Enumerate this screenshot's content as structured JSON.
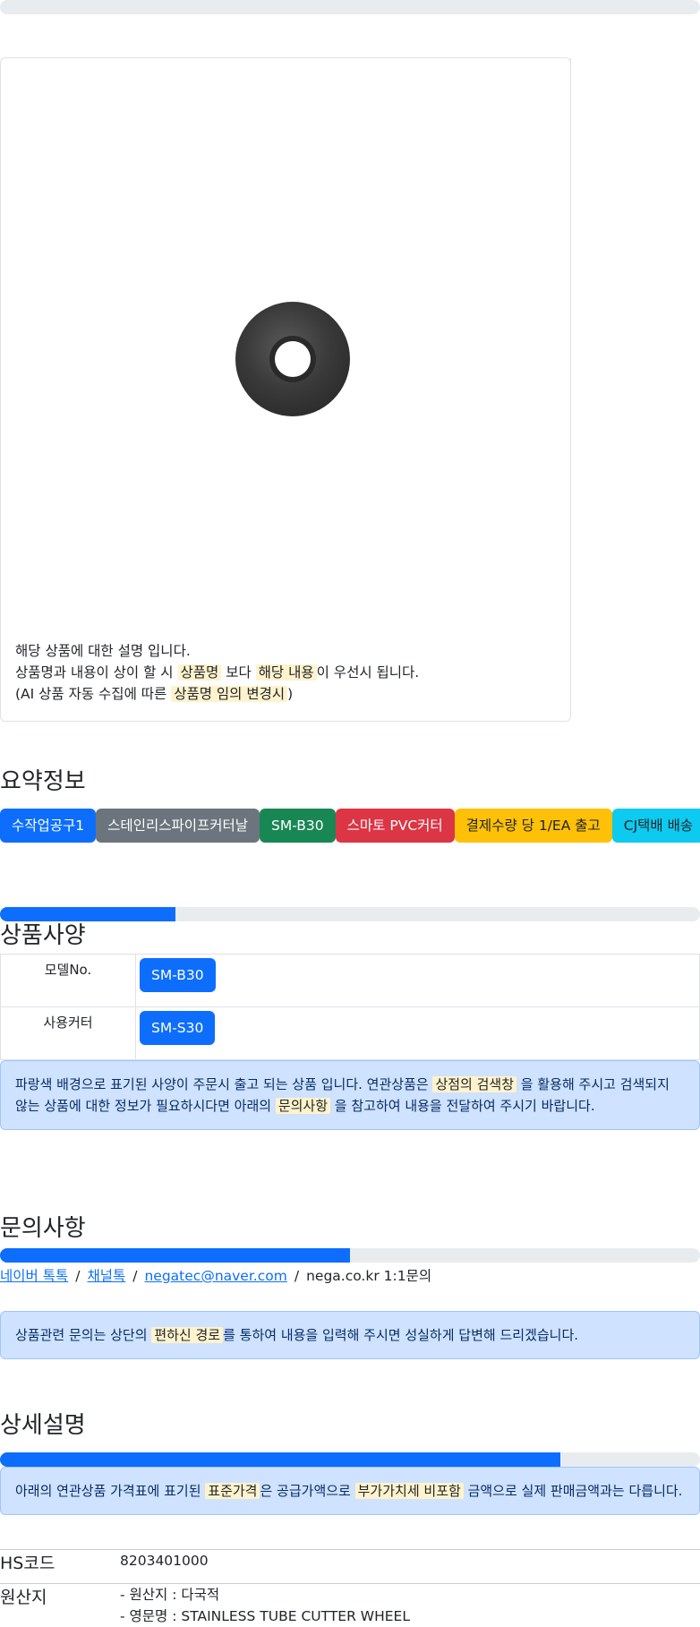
{
  "top_progress": 0,
  "card": {
    "image_alt": "stainless tube cutter wheel",
    "line1": "해당 상품에 대한 설명 입니다.",
    "line2_pre": "상품명과 내용이 상이 할 시 ",
    "line2_mark1": "상품명",
    "line2_mid": " 보다 ",
    "line2_mark2": "해당 내용",
    "line2_post": "이 우선시 됩니다.",
    "line3_pre": "(AI 상품 자동 수집에 따른 ",
    "line3_mark": "상품명 임의 변경시",
    "line3_post": ")"
  },
  "summary": {
    "title": "요약정보",
    "badges": [
      "수작업공구1",
      "스테인리스파이프커터날",
      "SM-B30",
      "스마토 PVC커터",
      "결제수량 당 1/EA 출고",
      "CJ택배 배송"
    ]
  },
  "spec": {
    "progress": 0.25,
    "title": "상품사양",
    "rows": [
      {
        "label": "모델No.",
        "value": "SM-B30"
      },
      {
        "label": "사용커터",
        "value": "SM-S30"
      }
    ],
    "notice_pre": "파랑색 배경으로 표기된 사양이 주문시 출고 되는 상품 입니다. 연관상품은 ",
    "notice_mark1": "상점의 검색창",
    "notice_mid": " 을 활용해 주시고 검색되지 않는 상품에 대한 정보가 필요하시다면 아래의 ",
    "notice_mark2": "문의사항",
    "notice_post": " 을 참고하여 내용을 전달하여 주시기 바랍니다."
  },
  "inquiry": {
    "title": "문의사항",
    "progress": 0.5,
    "links": [
      "네이버 톡톡",
      "채널톡",
      "negatec@naver.com"
    ],
    "plain": "nega.co.kr 1:1문의",
    "separator": "/",
    "notice_pre": "상품관련 문의는 상단의 ",
    "notice_mark": "편하신 경로",
    "notice_post": "를 통하여 내용을 입력해 주시면 성실하게 답변해 드리겠습니다."
  },
  "detail": {
    "title": "상세설명",
    "progress": 0.8,
    "notice_pre": "아래의 연관상품 가격표에 표기된 ",
    "notice_mark1": "표준가격",
    "notice_mid": "은 공급가액으로 ",
    "notice_mark2": "부가가치세 비포함",
    "notice_post": " 금액으로 실제 판매금액과는 다릅니다.",
    "hs_label": "HS코드",
    "hs_value": "8203401000",
    "origin_label": "원산지",
    "origin_line1": "- 원산지 : 다국적",
    "origin_line2": "- 영문명 : STAINLESS TUBE CUTTER WHEEL"
  }
}
